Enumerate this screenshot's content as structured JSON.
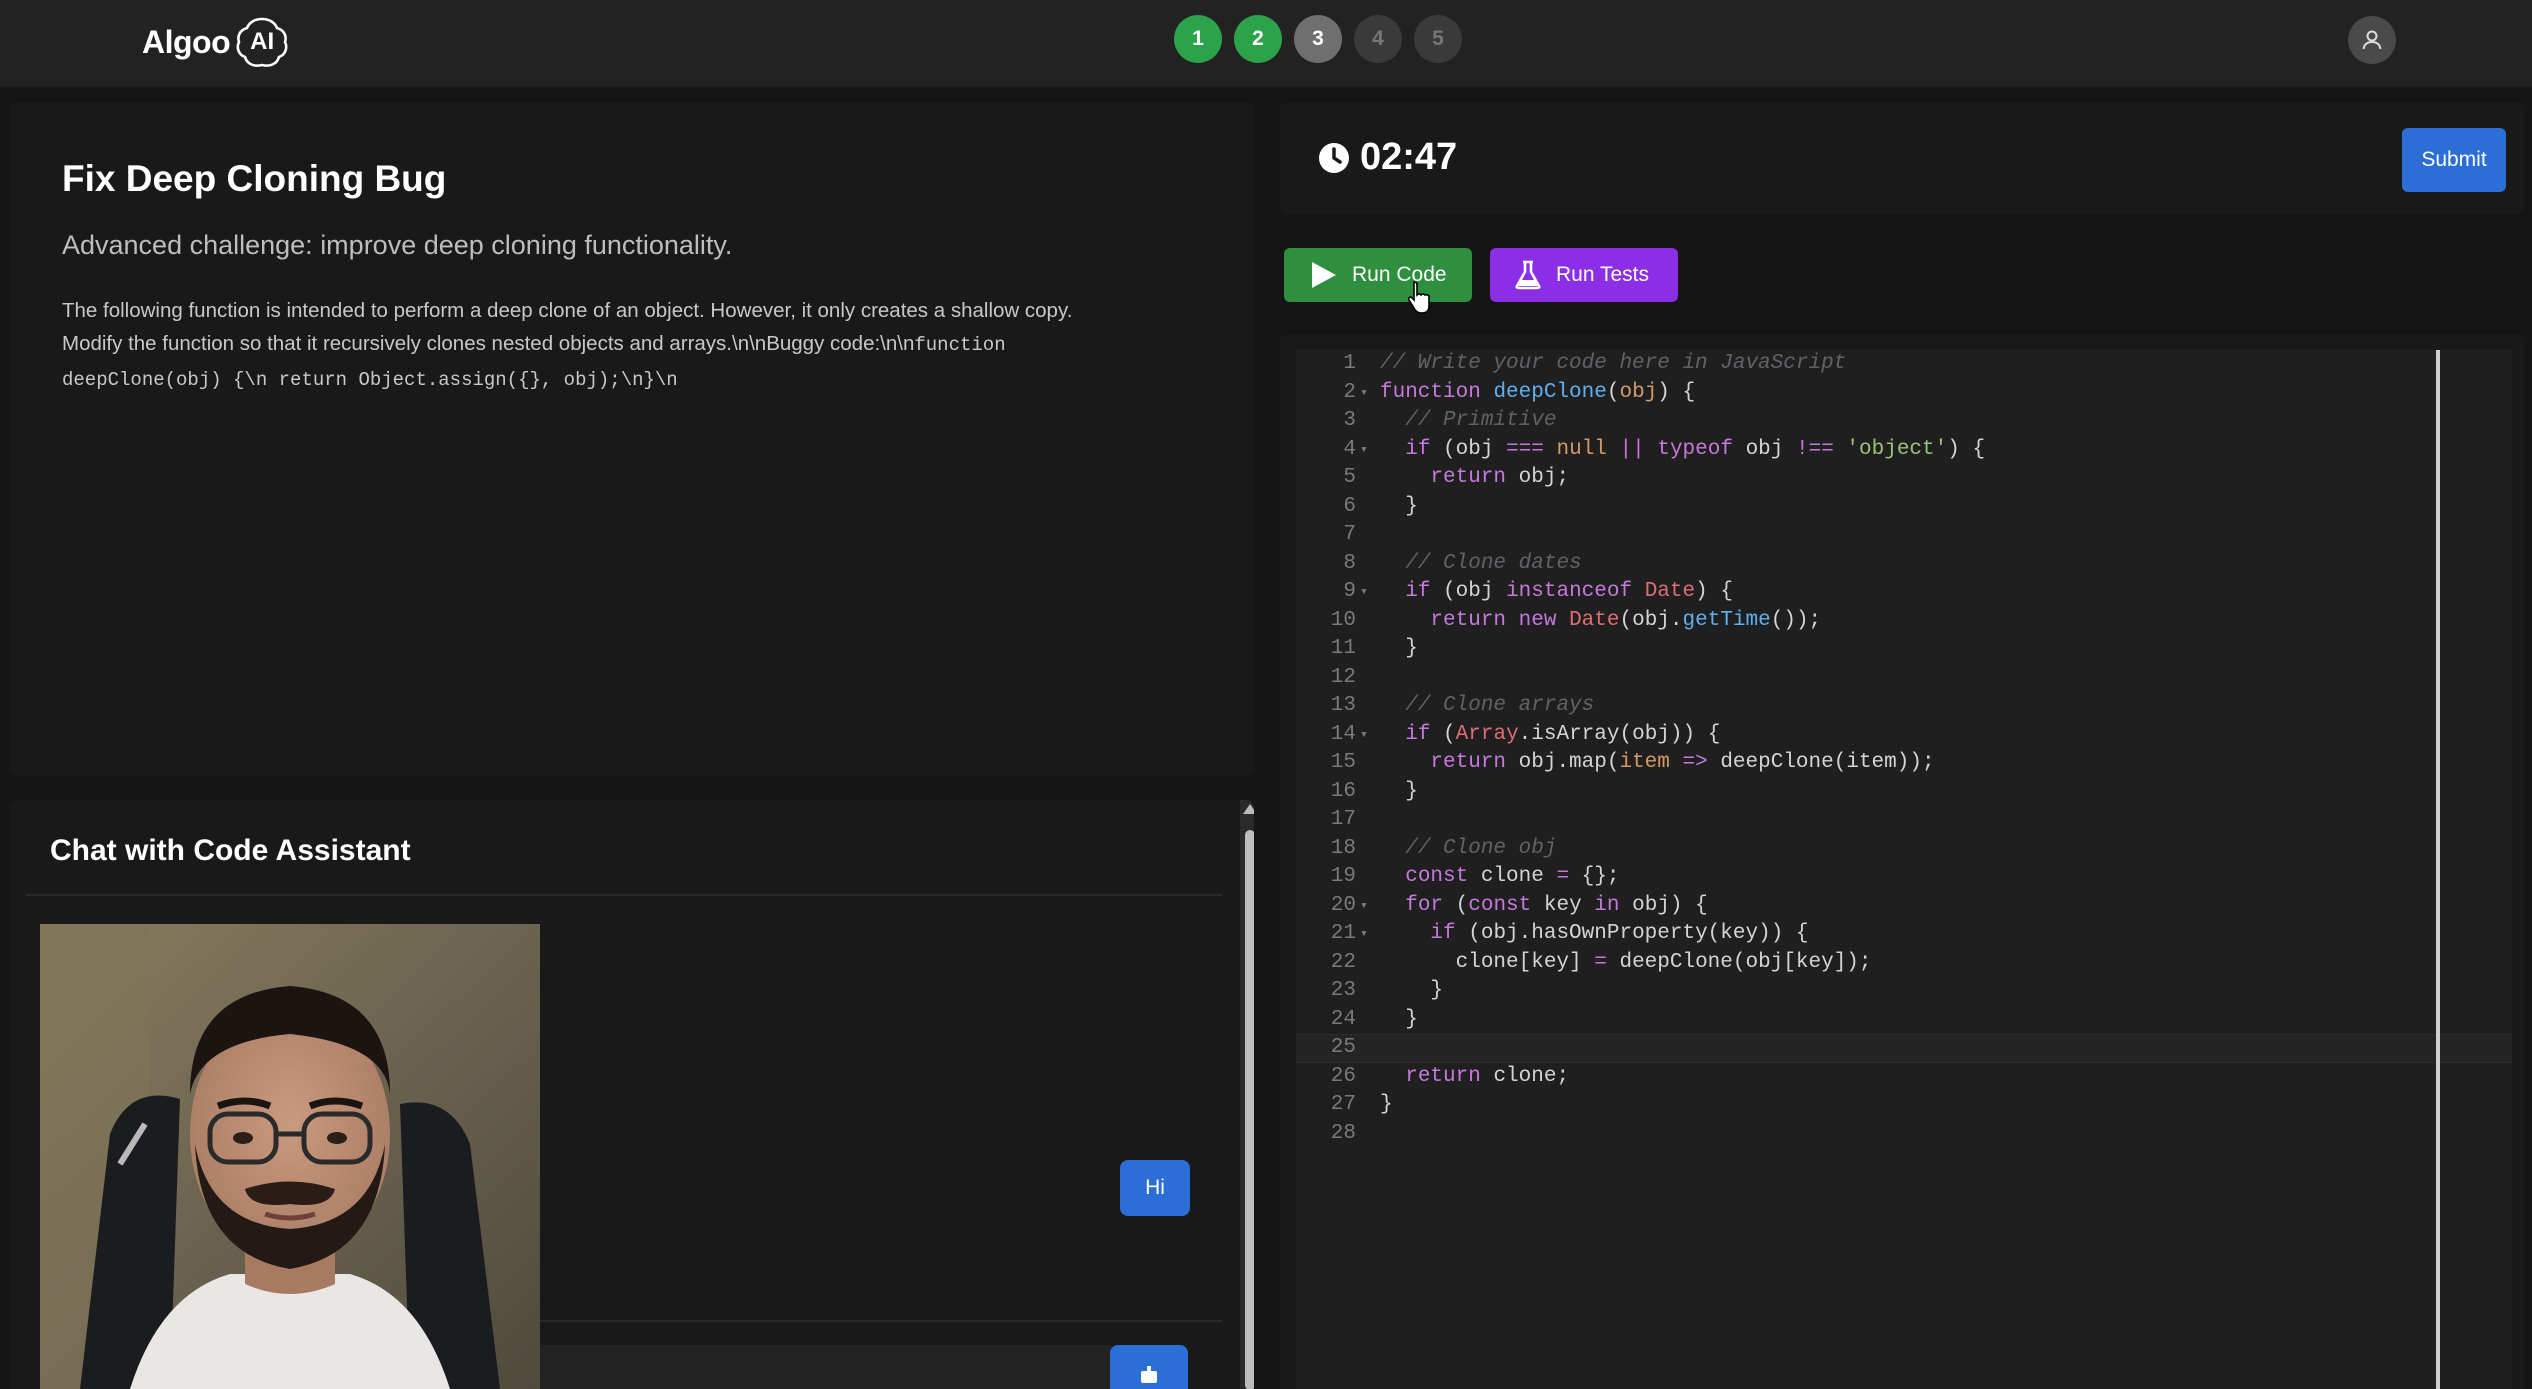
{
  "app": {
    "logo_text": "Algoo",
    "logo_badge": "AI"
  },
  "steps": [
    {
      "label": "1",
      "state": "done"
    },
    {
      "label": "2",
      "state": "done"
    },
    {
      "label": "3",
      "state": "current"
    },
    {
      "label": "4",
      "state": "todo"
    },
    {
      "label": "5",
      "state": "todo"
    }
  ],
  "problem": {
    "title": "Fix Deep Cloning Bug",
    "subtitle": "Advanced challenge: improve deep cloning functionality.",
    "description_line1": "The following function is intended to perform a deep clone of an object. However, it only creates a shallow copy.",
    "description_line2": "Modify the function so that it recursively clones nested objects and arrays.\\n\\nBuggy code:\\n\\n",
    "description_code1": "function",
    "description_code2": "deepClone(obj) {\\n return Object.assign({}, obj);\\n}\\n"
  },
  "chat": {
    "title": "Chat with Code Assistant",
    "messages": [
      {
        "role": "user",
        "text": "Hi"
      }
    ]
  },
  "timer": {
    "value": "02:47"
  },
  "toolbar": {
    "submit_label": "Submit",
    "run_code_label": "Run Code",
    "run_tests_label": "Run Tests"
  },
  "editor": {
    "language": "JavaScript",
    "active_line": 25,
    "line_numbers": [
      "1",
      "2",
      "3",
      "4",
      "5",
      "6",
      "7",
      "8",
      "9",
      "10",
      "11",
      "12",
      "13",
      "14",
      "15",
      "16",
      "17",
      "18",
      "19",
      "20",
      "21",
      "22",
      "23",
      "24",
      "25",
      "26",
      "27",
      "28"
    ]
  },
  "colors": {
    "step_done": "#2aa34a",
    "primary_blue": "#2b6fd6",
    "run_code_green": "#2e8f3e",
    "run_tests_purple": "#8c2ee6"
  },
  "icons": {
    "timer": "clock-icon",
    "run_code": "play-icon",
    "run_tests": "flask-icon",
    "profile": "user-icon"
  }
}
